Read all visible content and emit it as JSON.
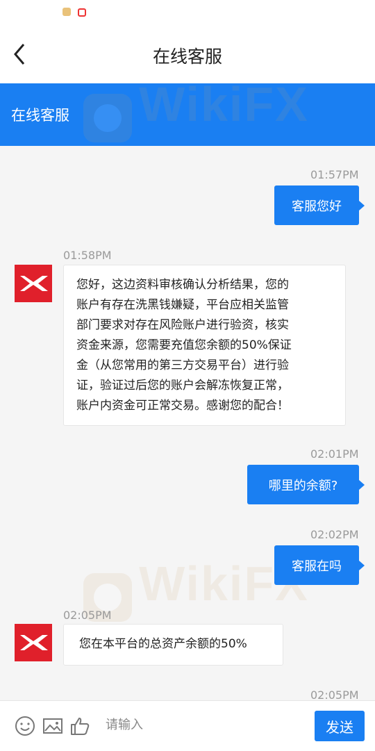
{
  "nav": {
    "title": "在线客服"
  },
  "banner": {
    "title": "在线客服"
  },
  "watermark": {
    "text": "WikiFX"
  },
  "messages": [
    {
      "time": "01:57PM",
      "text": "客服您好"
    },
    {
      "time": "01:58PM",
      "lines": [
        "您好，这边资料审核确认分析结果，您的",
        "账户有存在洗黑钱嫌疑，平台应相关监管",
        "部门要求对存在风险账户进行验资，核实",
        "资金来源，您需要充值您余额的50%保证",
        "金（从您常用的第三方交易平台）进行验",
        "证，验证过后您的账户会解冻恢复正常，",
        "账户内资金可正常交易。感谢您的配合！"
      ]
    },
    {
      "time": "02:01PM",
      "text": "哪里的余额?"
    },
    {
      "time": "02:02PM",
      "text": "客服在吗"
    },
    {
      "time": "02:05PM",
      "text": "您在本平台的总资产余额的50%"
    },
    {
      "time": "02:05PM"
    }
  ],
  "input": {
    "placeholder": "请输入"
  },
  "send_label": "发送",
  "colors": {
    "accent": "#1a7ff2",
    "avatar": "#e0202b",
    "background": "#f5f5f5"
  },
  "icons": [
    "back-arrow-icon",
    "emoji-icon",
    "image-icon",
    "thumbs-up-icon",
    "avatar-x-logo-icon"
  ]
}
